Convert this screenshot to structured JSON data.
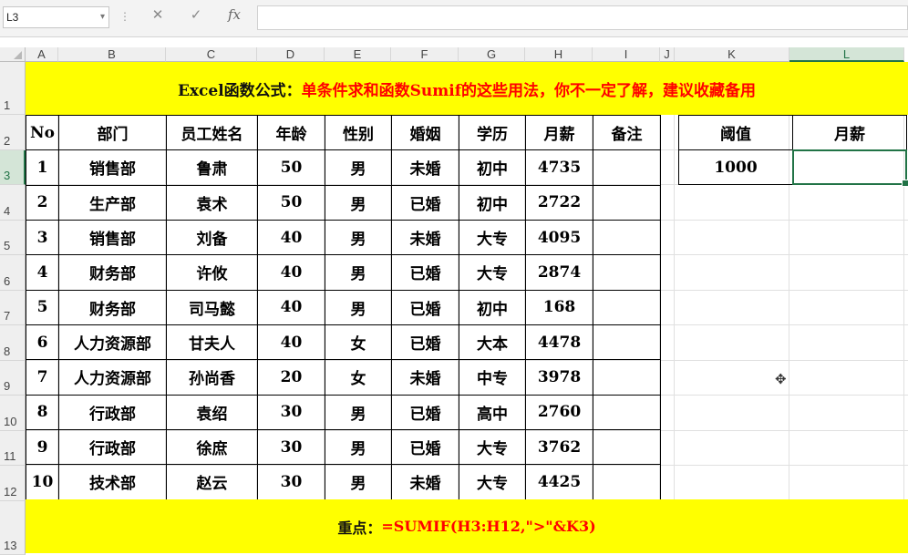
{
  "formula_bar": {
    "name_box": "L3",
    "dropdown": "▾",
    "divider": "⋮",
    "cancel": "✕",
    "enter": "✓",
    "fx": "fx",
    "formula": ""
  },
  "columns": [
    "A",
    "B",
    "C",
    "D",
    "E",
    "F",
    "G",
    "H",
    "I",
    "J",
    "K",
    "L"
  ],
  "rows": [
    "1",
    "2",
    "3",
    "4",
    "5",
    "6",
    "7",
    "8",
    "9",
    "10",
    "11",
    "12",
    "13"
  ],
  "title": {
    "prefix": "Excel函数公式：",
    "main": "单条件求和函数Sumif的这些用法，你不一定了解，建议收藏备用"
  },
  "table": {
    "headers": [
      "No",
      "部门",
      "员工姓名",
      "年龄",
      "性别",
      "婚姻",
      "学历",
      "月薪",
      "备注"
    ],
    "rows": [
      [
        "1",
        "销售部",
        "鲁肃",
        "50",
        "男",
        "未婚",
        "初中",
        "4735",
        ""
      ],
      [
        "2",
        "生产部",
        "袁术",
        "50",
        "男",
        "已婚",
        "初中",
        "2722",
        ""
      ],
      [
        "3",
        "销售部",
        "刘备",
        "40",
        "男",
        "未婚",
        "大专",
        "4095",
        ""
      ],
      [
        "4",
        "财务部",
        "许攸",
        "40",
        "男",
        "已婚",
        "大专",
        "2874",
        ""
      ],
      [
        "5",
        "财务部",
        "司马懿",
        "40",
        "男",
        "已婚",
        "初中",
        "168",
        ""
      ],
      [
        "6",
        "人力资源部",
        "甘夫人",
        "40",
        "女",
        "已婚",
        "大本",
        "4478",
        ""
      ],
      [
        "7",
        "人力资源部",
        "孙尚香",
        "20",
        "女",
        "未婚",
        "中专",
        "3978",
        ""
      ],
      [
        "8",
        "行政部",
        "袁绍",
        "30",
        "男",
        "已婚",
        "高中",
        "2760",
        ""
      ],
      [
        "9",
        "行政部",
        "徐庶",
        "30",
        "男",
        "已婚",
        "大专",
        "3762",
        ""
      ],
      [
        "10",
        "技术部",
        "赵云",
        "30",
        "男",
        "未婚",
        "大专",
        "4425",
        ""
      ]
    ]
  },
  "side": {
    "threshold_label": "阈值",
    "salary_label": "月薪",
    "threshold_value": "1000",
    "salary_value": ""
  },
  "footer": {
    "prefix": "重点：",
    "formula": "=SUMIF(H3:H12,\">\"&K3)"
  },
  "cursor_glyph": "✥"
}
